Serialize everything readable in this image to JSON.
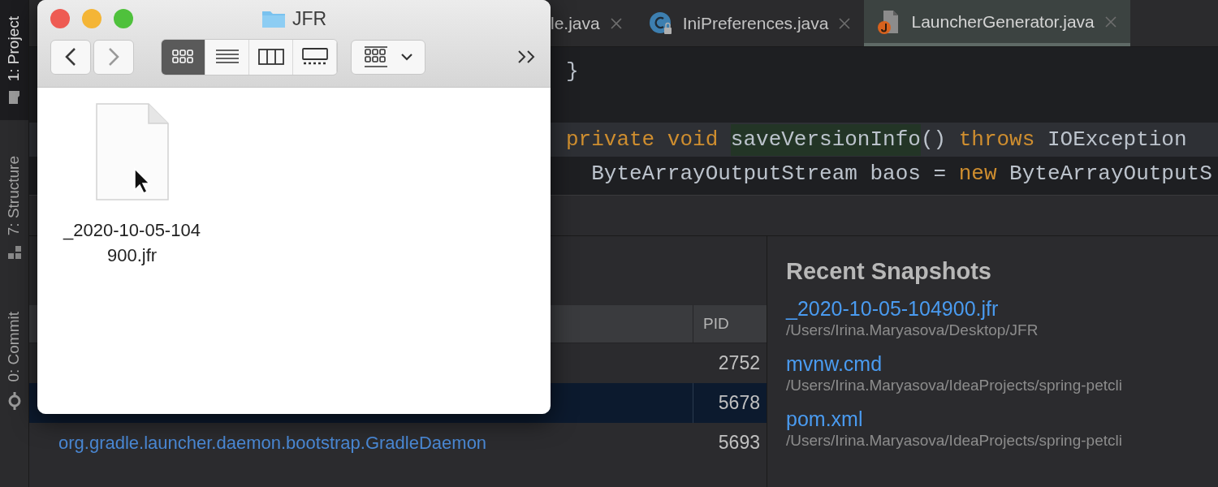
{
  "sidebar": {
    "tabs": [
      {
        "label": "1: Project",
        "kind": "project",
        "selected": true
      },
      {
        "label": "7: Structure",
        "kind": "structure",
        "selected": false
      },
      {
        "label": "0: Commit",
        "kind": "commit",
        "selected": false
      }
    ]
  },
  "editor": {
    "tabs": [
      {
        "label": "le.java",
        "kind": "hidden",
        "selected": false
      },
      {
        "label": "IniPreferences.java",
        "kind": "class",
        "selected": false
      },
      {
        "label": "LauncherGenerator.java",
        "kind": "java",
        "selected": true
      }
    ],
    "lines": [
      {
        "kind": "code",
        "current": false,
        "tokens": [
          {
            "text": "}",
            "kind": "plain"
          }
        ]
      },
      {
        "kind": "blank"
      },
      {
        "kind": "code",
        "current": true,
        "tokens": [
          {
            "text": "private void ",
            "kind": "keyword"
          },
          {
            "text": "saveVersionInfo",
            "kind": "usage"
          },
          {
            "text": "() ",
            "kind": "plain"
          },
          {
            "text": "throws ",
            "kind": "keyword"
          },
          {
            "text": "IOException",
            "kind": "plain"
          }
        ]
      },
      {
        "kind": "code",
        "current": false,
        "tokens": [
          {
            "text": "  ByteArrayOutputStream baos = ",
            "kind": "plain"
          },
          {
            "text": "new ",
            "kind": "keyword"
          },
          {
            "text": "ByteArrayOutputS",
            "kind": "plain"
          }
        ]
      }
    ]
  },
  "processes": {
    "pid_header": "PID",
    "rows": [
      {
        "pid": "2752",
        "selected": false
      },
      {
        "pid": "5678",
        "selected": true
      },
      {
        "name": "org.gradle.launcher.daemon.bootstrap.GradleDaemon",
        "pid": "5693",
        "selected": false
      }
    ]
  },
  "recent": {
    "title": "Recent Snapshots",
    "items": [
      {
        "name": "_2020-10-05-104900.jfr",
        "path": "/Users/Irina.Maryasova/Desktop/JFR"
      },
      {
        "name": "mvnw.cmd",
        "path": "/Users/Irina.Maryasova/IdeaProjects/spring-petcli"
      },
      {
        "name": "pom.xml",
        "path": "/Users/Irina.Maryasova/IdeaProjects/spring-petcli"
      }
    ]
  },
  "finder": {
    "title": "JFR",
    "nav": [
      {
        "kind": "back",
        "disabled": false
      },
      {
        "kind": "forward",
        "disabled": true
      }
    ],
    "view_modes": [
      {
        "kind": "icons",
        "selected": true
      },
      {
        "kind": "list",
        "selected": false
      },
      {
        "kind": "columns",
        "selected": false
      },
      {
        "kind": "gallery",
        "selected": false
      }
    ],
    "files": [
      {
        "name": "_2020-10-05-104900.jfr"
      }
    ]
  }
}
